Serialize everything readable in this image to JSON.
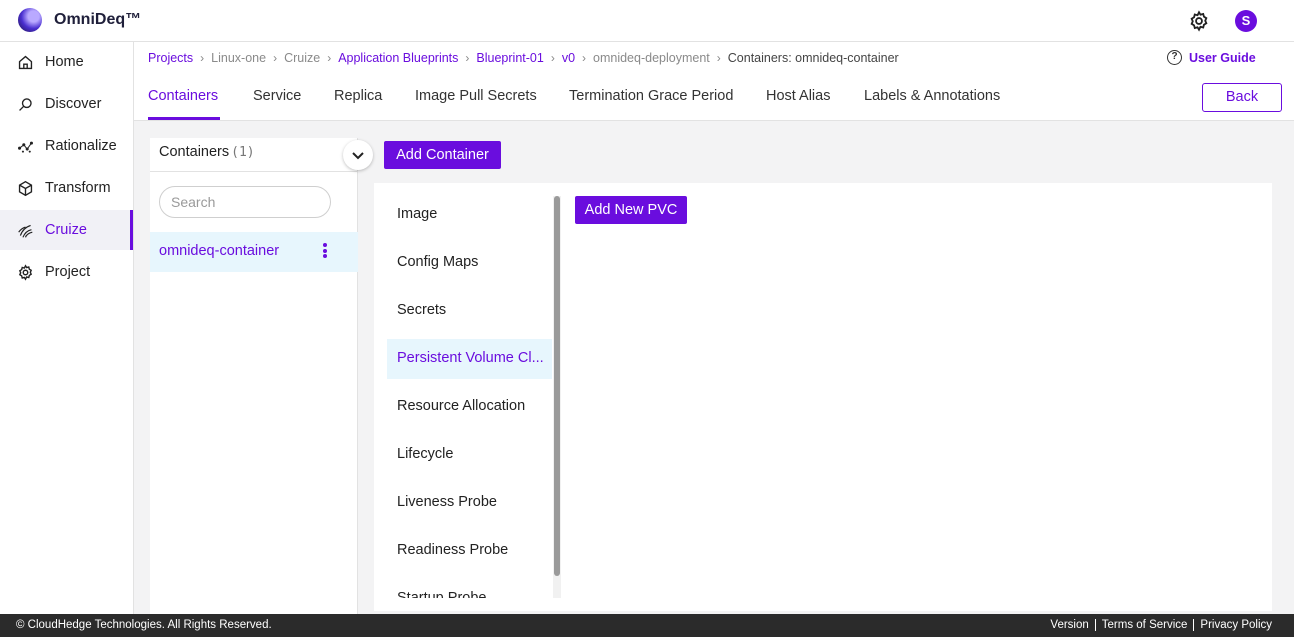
{
  "header": {
    "brand": "OmniDeq™",
    "avatar_letter": "S",
    "settings_icon": "gear-icon"
  },
  "sidebar": {
    "items": [
      {
        "label": "Home",
        "icon": "home-icon"
      },
      {
        "label": "Discover",
        "icon": "discover-icon"
      },
      {
        "label": "Rationalize",
        "icon": "rationalize-icon"
      },
      {
        "label": "Transform",
        "icon": "cube-icon"
      },
      {
        "label": "Cruize",
        "icon": "cruize-icon",
        "active": true
      },
      {
        "label": "Project",
        "icon": "project-gear-icon"
      }
    ]
  },
  "breadcrumb": {
    "items": [
      "Projects",
      "Linux-one",
      "Cruize",
      "Application Blueprints",
      "Blueprint-01",
      "v0",
      "omnideq-deployment",
      "Containers: omnideq-container"
    ]
  },
  "user_guide": "User Guide",
  "tabs": [
    "Containers",
    "Service",
    "Replica",
    "Image Pull Secrets",
    "Termination Grace Period",
    "Host Alias",
    "Labels & Annotations"
  ],
  "back_label": "Back",
  "containers_panel": {
    "title": "Containers",
    "count": "(1)",
    "search_placeholder": "Search",
    "items": [
      "omnideq-container"
    ]
  },
  "add_container_label": "Add Container",
  "sections": [
    "Image",
    "Config Maps",
    "Secrets",
    "Persistent Volume Cl...",
    "Resource Allocation",
    "Lifecycle",
    "Liveness Probe",
    "Readiness Probe",
    "Startup Probe"
  ],
  "active_section": "Persistent Volume Cl...",
  "add_pvc_label": "Add New PVC",
  "footer": {
    "copyright": "© CloudHedge Technologies. All Rights Reserved.",
    "links": [
      "Version",
      "Terms of Service",
      "Privacy Policy"
    ]
  },
  "colors": {
    "accent": "#6a0dde",
    "selected_bg": "#e7f6fd",
    "footer_bg": "#2b2b2b"
  }
}
